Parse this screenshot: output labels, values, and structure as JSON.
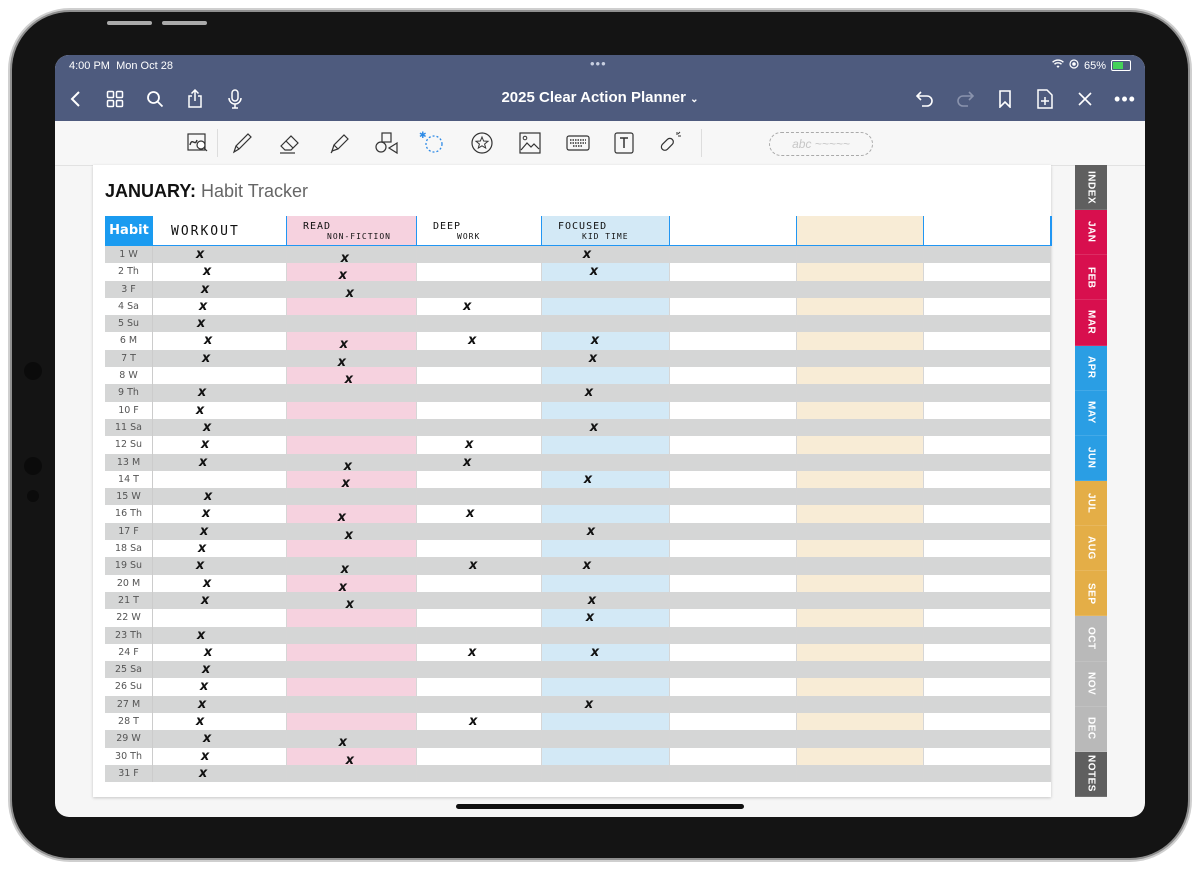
{
  "status_bar": {
    "time": "4:00 PM",
    "date": "Mon Oct 28",
    "battery": "65%",
    "battery_level": 0.65,
    "icons": [
      "wifi-icon",
      "screen-lock-icon"
    ]
  },
  "nav": {
    "title": "2025 Clear Action Planner",
    "left_icons": [
      "back-icon",
      "thumbnails-icon",
      "search-icon",
      "share-icon",
      "microphone-icon"
    ],
    "right_icons": [
      "undo-icon",
      "redo-icon",
      "bookmark-icon",
      "add-page-icon",
      "close-read-only-icon",
      "more-icon"
    ]
  },
  "toolbar": {
    "tools": [
      "zoom-box-tool",
      "pen-tool",
      "eraser-tool",
      "highlighter-tool",
      "shapes-tool",
      "lasso-tool",
      "sticker-tool",
      "image-tool",
      "keyboard-tool",
      "text-box-tool",
      "laser-pointer-tool"
    ],
    "convert_placeholder": "abc ~~~~~"
  },
  "page": {
    "title_bold": "JANUARY:",
    "title_light": " Habit Tracker",
    "habit_header": "Habit",
    "columns": [
      {
        "line1": "WORKOUT",
        "line2": "",
        "color": "white"
      },
      {
        "line1": "READ",
        "line2": "NON-FICTION",
        "color": "pink"
      },
      {
        "line1": "DEEP",
        "line2": "WORK",
        "color": "white"
      },
      {
        "line1": "FOCUSED",
        "line2": "KID TIME",
        "color": "blue"
      },
      {
        "line1": "",
        "line2": "",
        "color": "white"
      },
      {
        "line1": "",
        "line2": "",
        "color": "tan"
      },
      {
        "line1": "",
        "line2": "",
        "color": "white"
      }
    ],
    "days": [
      "1 W",
      "2 Th",
      "3 F",
      "4 Sa",
      "5 Su",
      "6 M",
      "7 T",
      "8 W",
      "9 Th",
      "10 F",
      "11 Sa",
      "12 Su",
      "13 M",
      "14 T",
      "15 W",
      "16 Th",
      "17 F",
      "18 Sa",
      "19 Su",
      "20 M",
      "21 T",
      "22 W",
      "23 Th",
      "24 F",
      "25 Sa",
      "26 Su",
      "27 M",
      "28 T",
      "29 W",
      "30 Th",
      "31 F"
    ],
    "checks": [
      [
        1,
        1,
        0,
        1,
        0,
        0,
        0
      ],
      [
        1,
        1,
        0,
        1,
        0,
        0,
        0
      ],
      [
        1,
        1,
        0,
        0,
        0,
        0,
        0
      ],
      [
        1,
        0,
        1,
        0,
        0,
        0,
        0
      ],
      [
        1,
        0,
        0,
        0,
        0,
        0,
        0
      ],
      [
        1,
        1,
        1,
        1,
        0,
        0,
        0
      ],
      [
        1,
        1,
        0,
        1,
        0,
        0,
        0
      ],
      [
        0,
        1,
        0,
        0,
        0,
        0,
        0
      ],
      [
        1,
        0,
        0,
        1,
        0,
        0,
        0
      ],
      [
        1,
        0,
        0,
        0,
        0,
        0,
        0
      ],
      [
        1,
        0,
        0,
        1,
        0,
        0,
        0
      ],
      [
        1,
        0,
        1,
        0,
        0,
        0,
        0
      ],
      [
        1,
        1,
        1,
        0,
        0,
        0,
        0
      ],
      [
        0,
        1,
        0,
        1,
        0,
        0,
        0
      ],
      [
        1,
        0,
        0,
        0,
        0,
        0,
        0
      ],
      [
        1,
        1,
        1,
        0,
        0,
        0,
        0
      ],
      [
        1,
        1,
        0,
        1,
        0,
        0,
        0
      ],
      [
        1,
        0,
        0,
        0,
        0,
        0,
        0
      ],
      [
        1,
        1,
        1,
        1,
        0,
        0,
        0
      ],
      [
        1,
        1,
        0,
        0,
        0,
        0,
        0
      ],
      [
        1,
        1,
        0,
        1,
        0,
        0,
        0
      ],
      [
        0,
        0,
        0,
        1,
        0,
        0,
        0
      ],
      [
        1,
        0,
        0,
        0,
        0,
        0,
        0
      ],
      [
        1,
        0,
        1,
        1,
        0,
        0,
        0
      ],
      [
        1,
        0,
        0,
        0,
        0,
        0,
        0
      ],
      [
        1,
        0,
        0,
        0,
        0,
        0,
        0
      ],
      [
        1,
        0,
        0,
        1,
        0,
        0,
        0
      ],
      [
        1,
        0,
        1,
        0,
        0,
        0,
        0
      ],
      [
        1,
        1,
        0,
        0,
        0,
        0,
        0
      ],
      [
        1,
        1,
        0,
        0,
        0,
        0,
        0
      ],
      [
        1,
        0,
        0,
        0,
        0,
        0,
        0
      ]
    ],
    "mark_glyph": "x"
  },
  "tabs": [
    {
      "label": "INDEX",
      "color": "#5f5f5f"
    },
    {
      "label": "JAN",
      "color": "#d80f4e"
    },
    {
      "label": "FEB",
      "color": "#d80f4e"
    },
    {
      "label": "MAR",
      "color": "#d80f4e"
    },
    {
      "label": "APR",
      "color": "#2a9ee4"
    },
    {
      "label": "MAY",
      "color": "#2a9ee4"
    },
    {
      "label": "JUN",
      "color": "#2a9ee4"
    },
    {
      "label": "JUL",
      "color": "#e4ae47"
    },
    {
      "label": "AUG",
      "color": "#e4ae47"
    },
    {
      "label": "SEP",
      "color": "#e4ae47"
    },
    {
      "label": "OCT",
      "color": "#b9b9b9"
    },
    {
      "label": "NOV",
      "color": "#b9b9b9"
    },
    {
      "label": "DEC",
      "color": "#b9b9b9"
    },
    {
      "label": "NOTES",
      "color": "#5f5f5f"
    }
  ]
}
